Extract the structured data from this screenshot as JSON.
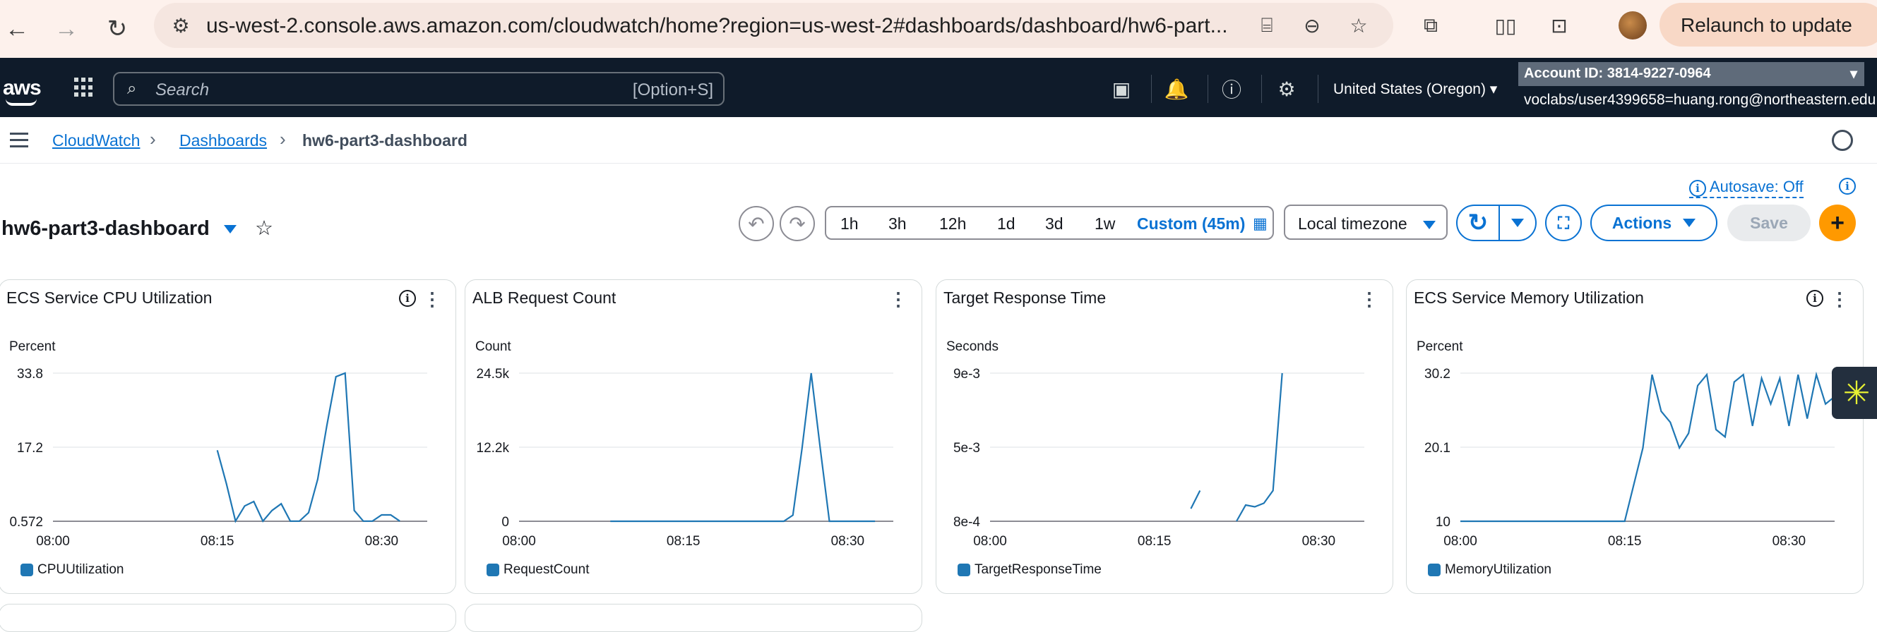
{
  "browser": {
    "url": "us-west-2.console.aws.amazon.com/cloudwatch/home?region=us-west-2#dashboards/dashboard/hw6-part...",
    "relaunch_label": "Relaunch to update"
  },
  "aws_header": {
    "logo": "aws",
    "search_placeholder": "Search",
    "search_shortcut": "[Option+S]",
    "region": "United States (Oregon)",
    "account_id": "Account ID: 3814-9227-0964",
    "user": "voclabs/user4399658=huang.rong@northeastern.edu"
  },
  "breadcrumb": {
    "items": [
      "CloudWatch",
      "Dashboards",
      "hw6-part3-dashboard"
    ]
  },
  "dashboard": {
    "title": "hw6-part3-dashboard",
    "autosave": "Autosave: Off",
    "time_options": [
      "1h",
      "3h",
      "12h",
      "1d",
      "3d",
      "1w",
      "Custom (45m)"
    ],
    "timezone": "Local timezone",
    "actions_label": "Actions",
    "save_label": "Save"
  },
  "widgets": [
    {
      "title": "ECS Service CPU Utilization",
      "unit": "Percent",
      "y_ticks": [
        "33.8",
        "17.2",
        "0.572"
      ],
      "x_ticks": [
        "08:00",
        "08:15",
        "08:30"
      ],
      "legend": "CPUUtilization",
      "has_info": true
    },
    {
      "title": "ALB Request Count",
      "unit": "Count",
      "y_ticks": [
        "24.5k",
        "12.2k",
        "0"
      ],
      "x_ticks": [
        "08:00",
        "08:15",
        "08:30"
      ],
      "legend": "RequestCount",
      "has_info": false
    },
    {
      "title": "Target Response Time",
      "unit": "Seconds",
      "y_ticks": [
        "9e-3",
        "5e-3",
        "8e-4"
      ],
      "x_ticks": [
        "08:00",
        "08:15",
        "08:30"
      ],
      "legend": "TargetResponseTime",
      "has_info": false
    },
    {
      "title": "ECS Service Memory Utilization",
      "unit": "Percent",
      "y_ticks": [
        "30.2",
        "20.1",
        "10"
      ],
      "x_ticks": [
        "08:00",
        "08:15",
        "08:30"
      ],
      "legend": "MemoryUtilization",
      "has_info": true
    }
  ],
  "chart_data": [
    {
      "type": "line",
      "title": "ECS Service CPU Utilization",
      "ylabel": "Percent",
      "ylim": [
        0.572,
        33.8
      ],
      "x_ticks": [
        "08:00",
        "08:15",
        "08:30"
      ],
      "series": [
        {
          "name": "CPUUtilization",
          "x": [
            58,
            59,
            60,
            61,
            62,
            63,
            64,
            65,
            66,
            67,
            68,
            69,
            70,
            71,
            72,
            73,
            74,
            75,
            76,
            77,
            78
          ],
          "y": [
            16.5,
            9.0,
            0.6,
            4.0,
            5.0,
            0.6,
            3.0,
            4.5,
            0.6,
            0.6,
            2.5,
            10.0,
            22.0,
            33.0,
            33.8,
            3.0,
            0.6,
            0.6,
            2.0,
            2.0,
            0.6
          ]
        }
      ]
    },
    {
      "type": "line",
      "title": "ALB Request Count",
      "ylabel": "Count",
      "ylim": [
        0,
        24500
      ],
      "x_ticks": [
        "08:00",
        "08:15",
        "08:30"
      ],
      "series": [
        {
          "name": "RequestCount",
          "x": [
            50,
            60,
            67,
            68,
            69,
            70,
            71,
            72,
            73,
            74,
            75,
            76,
            77,
            78,
            79
          ],
          "y": [
            0,
            0,
            0,
            0,
            0,
            1000,
            12000,
            24500,
            12000,
            0,
            0,
            0,
            0,
            0,
            0
          ]
        }
      ]
    },
    {
      "type": "line",
      "title": "Target Response Time",
      "ylabel": "Seconds",
      "ylim": [
        0.0008,
        0.009
      ],
      "x_ticks": [
        "08:00",
        "08:15",
        "08:30"
      ],
      "series": [
        {
          "name": "TargetResponseTime",
          "segments": [
            {
              "x": [
                62,
                63
              ],
              "y": [
                0.0015,
                0.0025
              ]
            },
            {
              "x": [
                67,
                68,
                69,
                70,
                71,
                72
              ],
              "y": [
                0.0008,
                0.0017,
                0.0016,
                0.0018,
                0.0025,
                0.009
              ]
            }
          ]
        }
      ]
    },
    {
      "type": "line",
      "title": "ECS Service Memory Utilization",
      "ylabel": "Percent",
      "ylim": [
        10,
        30.2
      ],
      "x_ticks": [
        "08:00",
        "08:15",
        "08:30"
      ],
      "series": [
        {
          "name": "MemoryUtilization",
          "x": [
            40,
            58,
            60,
            61,
            62,
            63,
            64,
            65,
            66,
            67,
            68,
            69,
            70,
            71,
            72,
            73,
            74,
            75,
            76,
            77,
            78,
            79,
            80,
            81,
            82,
            83
          ],
          "y": [
            10,
            10,
            20,
            30,
            25,
            23.5,
            20,
            22,
            28.5,
            30,
            22.5,
            21.5,
            29,
            30,
            23,
            29.5,
            26,
            29.5,
            23,
            30,
            24,
            30,
            26,
            27,
            30,
            30.2
          ]
        }
      ]
    }
  ],
  "colors": {
    "series": "#1f77b4",
    "link": "#0972d3",
    "aws_bar": "#0f1b2a",
    "add_button": "#ff9900"
  }
}
